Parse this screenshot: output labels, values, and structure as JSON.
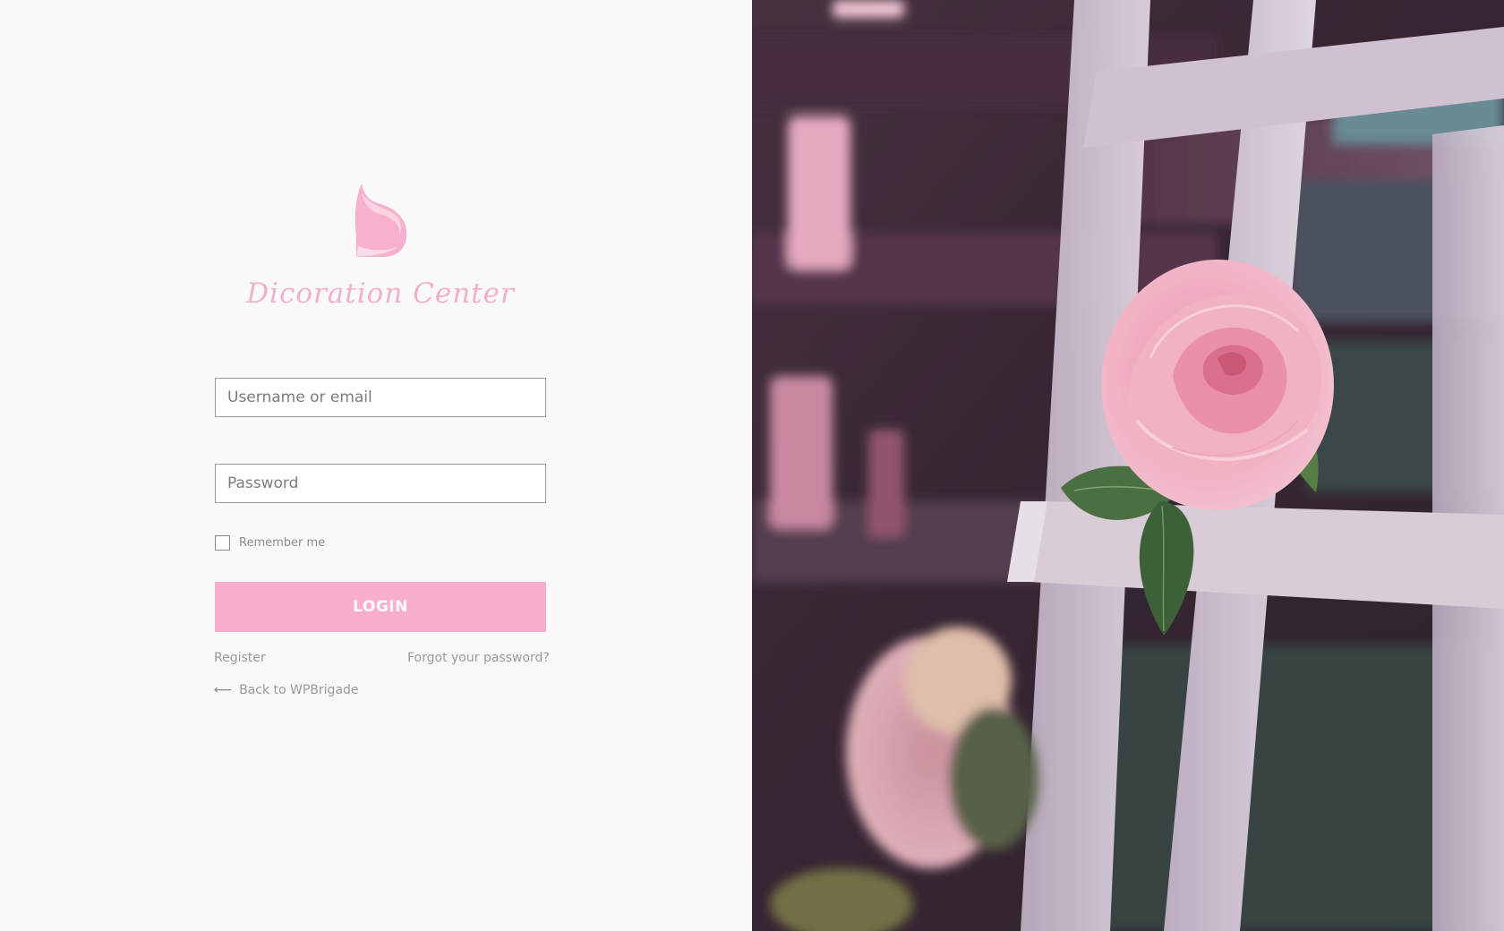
{
  "brand": {
    "name": "Dicoration Center",
    "color": "#f3b0cc"
  },
  "form": {
    "username_placeholder": "Username or email",
    "password_placeholder": "Password",
    "remember_label": "Remember me",
    "remember_checked": false,
    "login_label": "LOGIN",
    "button_color": "#f8aecd"
  },
  "links": {
    "register": "Register",
    "forgot_password": "Forgot your password?",
    "back": "Back to WPBrigade",
    "back_icon": "left-arrow-icon"
  },
  "background_image": {
    "description_icon": "rose-on-trellis-photo"
  }
}
